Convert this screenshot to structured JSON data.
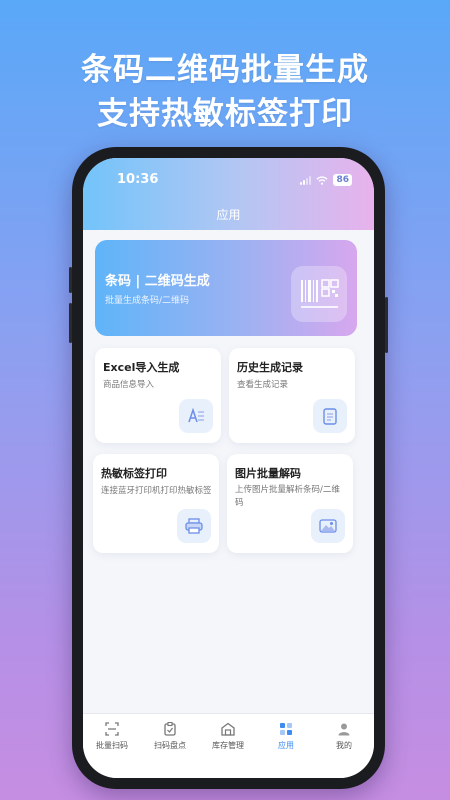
{
  "headline": {
    "line1": "条码二维码批量生成",
    "line2": "支持热敏标签打印"
  },
  "status_bar": {
    "time": "10:36",
    "battery": "86"
  },
  "app": {
    "title": "应用"
  },
  "banner": {
    "title": "条码 | 二维码生成",
    "subtitle": "批量生成条码/二维码"
  },
  "cards": [
    {
      "title": "Excel导入生成",
      "subtitle": "商品信息导入",
      "icon": "text-import-icon"
    },
    {
      "title": "历史生成记录",
      "subtitle": "查看生成记录",
      "icon": "document-icon"
    },
    {
      "title": "热敏标签打印",
      "subtitle": "连接蓝牙打印机打印热敏标签",
      "icon": "printer-icon"
    },
    {
      "title": "图片批量解码",
      "subtitle": "上传图片批量解析条码/二维码",
      "icon": "image-icon"
    }
  ],
  "tabs": [
    {
      "label": "批量扫码",
      "icon": "scan-icon"
    },
    {
      "label": "扫码盘点",
      "icon": "clipboard-icon"
    },
    {
      "label": "库存管理",
      "icon": "warehouse-icon"
    },
    {
      "label": "应用",
      "icon": "apps-icon",
      "active": true
    },
    {
      "label": "我的",
      "icon": "profile-icon"
    }
  ],
  "colors": {
    "accent": "#3f8cf0",
    "background_top": "#5aa8f8",
    "background_bottom": "#c68ee2"
  }
}
